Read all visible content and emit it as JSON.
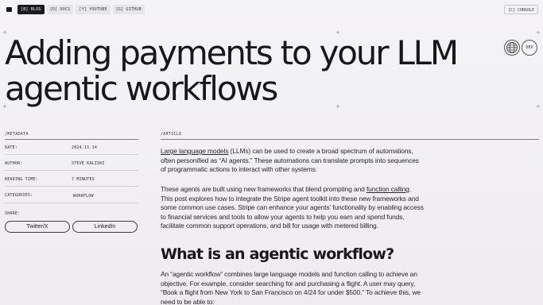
{
  "nav": {
    "items": [
      {
        "label": "[B] BLOG",
        "active": true
      },
      {
        "label": "[D] DOCS",
        "active": false
      },
      {
        "label": "[Y] YOUTUBE",
        "active": false
      },
      {
        "label": "[G] GITHUB",
        "active": false
      }
    ],
    "console_label": "[C] CONSOLE"
  },
  "hero": {
    "title_line1": "Adding payments to your LLM",
    "title_line2": "agentic workflows"
  },
  "header_buttons": {
    "dev_label": "DEV"
  },
  "metadata": {
    "section_label": "/METADATA",
    "date_key": "DATE:",
    "date_val": "2024.11.14",
    "author_key": "AUTHOR:",
    "author_val": "STEVE KALISKI",
    "reading_key": "READING TIME:",
    "reading_val": "7 MINUTES",
    "categories_key": "CATEGORIES:",
    "categories_val": "WORKFLOW",
    "share_key": "SHARE:",
    "share_twitter": "Twitter/X",
    "share_linkedin": "LinkedIn"
  },
  "article": {
    "section_label": "/ARTICLE",
    "p1_link": "Large language models",
    "p1_a": " (LLMs) can be used to create a broad spectrum of automations,",
    "p1_b": "often personified as “AI agents.” These automations can translate prompts into sequences",
    "p1_c": "of programmatic actions to interact with other systems.",
    "p2_a": "These agents are built using new frameworks that blend prompting and ",
    "p2_link": "function calling",
    "p2_a_end": ".",
    "p2_b": "This post explores how to integrate the Stripe agent toolkit into these new frameworks and",
    "p2_c": "some common use cases. Stripe can enhance your agents’ functionality by enabling access",
    "p2_d": "to financial services and tools to allow your agents to help you earn and spend funds,",
    "p2_e": "facilitate common support operations, and bill for usage with metered billing.",
    "h2": "What is an agentic workflow?",
    "p3_a": "An “agentic workflow” combines large language models and function calling to achieve an",
    "p3_b": "objective. For example, consider searching for and purchasing a flight. A user may query,",
    "p3_c": "“Book a flight from New York to San Francisco on 4/24 for under $500.” To achieve this, we",
    "p3_d": "need to be able to:"
  }
}
